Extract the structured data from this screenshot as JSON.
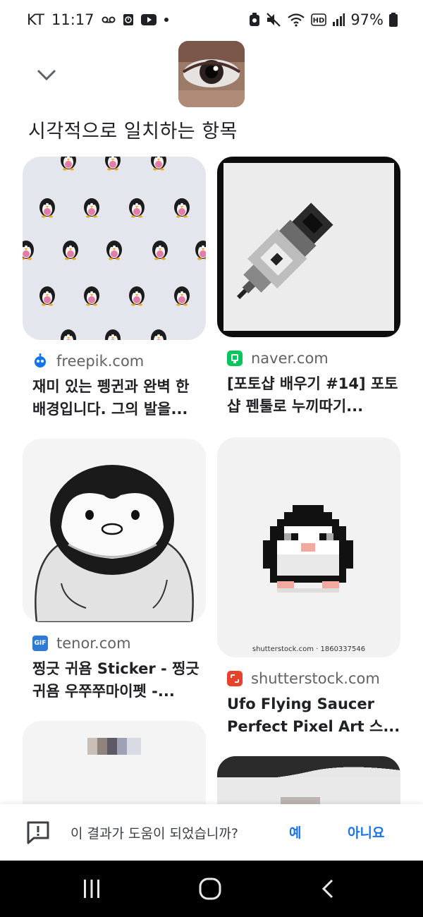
{
  "status_bar": {
    "carrier": "KT",
    "time": "11:17",
    "battery": "97%",
    "icons": [
      "voicemail-icon",
      "alarm-icon",
      "youtube-icon",
      "dot-icon",
      "nfc-icon",
      "mute-icon",
      "wifi-icon",
      "hd-icon",
      "signal-icon",
      "battery-icon"
    ]
  },
  "header": {
    "section_title": "시각적으로 일치하는 항목"
  },
  "results": [
    {
      "domain": "freepik.com",
      "favicon": "freepik-icon",
      "description": "재미 있는 펭귄과 완벽 한 배경입니다. 그의 발을..."
    },
    {
      "domain": "naver.com",
      "favicon": "naver-icon",
      "description": "[포토샵 배우기 #14] 포토샵 펜툴로 누끼따기..."
    },
    {
      "domain": "tenor.com",
      "favicon": "tenor-gif-icon",
      "favicon_text": "GIF",
      "description": "찡긋 귀욤 Sticker - 찡긋 귀욤 우쭈쭈마이펫 -..."
    },
    {
      "domain": "shutterstock.com",
      "favicon": "shutterstock-icon",
      "description": "Ufo Flying Saucer Perfect Pixel Art 스...",
      "watermark": "shutterstock.com · 1860337546"
    }
  ],
  "feedback": {
    "question": "이 결과가 도움이 되었습니까?",
    "yes": "예",
    "no": "아니요"
  },
  "colors": {
    "link_blue": "#1a73e8",
    "text_primary": "#202124",
    "text_secondary": "#5f6368",
    "navbar": "#000000"
  }
}
